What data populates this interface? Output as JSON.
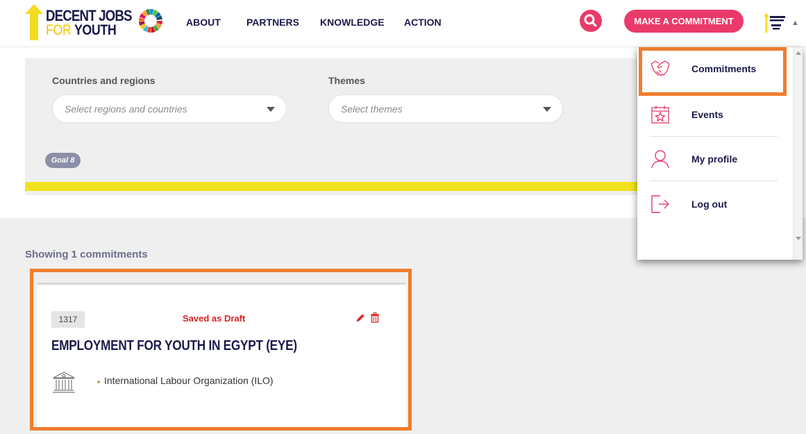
{
  "header": {
    "logo_line1": "DECENT JOBS",
    "logo_line2_a": "FOR",
    "logo_line2_b": "YOUTH",
    "nav": [
      "ABOUT",
      "PARTNERS",
      "KNOWLEDGE",
      "ACTION"
    ],
    "commit_button": "MAKE A COMMITMENT",
    "search_icon": "search-icon",
    "avatar_icon": "user-avatar-logo"
  },
  "filters": {
    "countries_label": "Countries and regions",
    "countries_placeholder": "Select regions and countries",
    "themes_label": "Themes",
    "themes_placeholder": "Select themes",
    "goal_tag": "Goal 8",
    "bar_color": "#f2e21e"
  },
  "results": {
    "showing": "Showing 1 commitments",
    "cards": [
      {
        "id": "1317",
        "status": "Saved as Draft",
        "title": "EMPLOYMENT FOR YOUTH IN EGYPT (EYE)",
        "organization": "International Labour Organization (ILO)",
        "icons": [
          "edit-icon",
          "trash-icon",
          "institution-icon"
        ]
      }
    ]
  },
  "dropdown": {
    "items": [
      {
        "label": "Commitments",
        "icon": "handshake-icon"
      },
      {
        "label": "Events",
        "icon": "calendar-star-icon"
      },
      {
        "label": "My profile",
        "icon": "user-icon"
      },
      {
        "label": "Log out",
        "icon": "logout-icon"
      }
    ]
  },
  "colors": {
    "accent": "#ea3a6a",
    "navy": "#1b1a4a",
    "highlight": "#ef7d2c",
    "status_red": "#e02020"
  }
}
